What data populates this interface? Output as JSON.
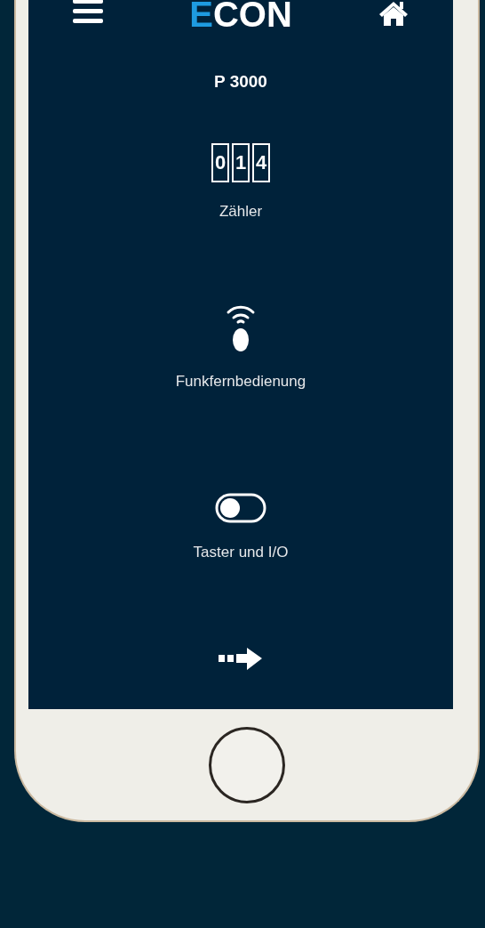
{
  "header": {
    "logo": {
      "accent": "E",
      "rest": "CON"
    }
  },
  "device": {
    "title": "P 3000"
  },
  "menu": [
    {
      "kind": "counter",
      "label": "Zähler",
      "digits": [
        "0",
        "1",
        "4"
      ]
    },
    {
      "kind": "remote",
      "label": "Funkfernbedienung"
    },
    {
      "kind": "toggle",
      "label": "Taster und I/O"
    }
  ]
}
